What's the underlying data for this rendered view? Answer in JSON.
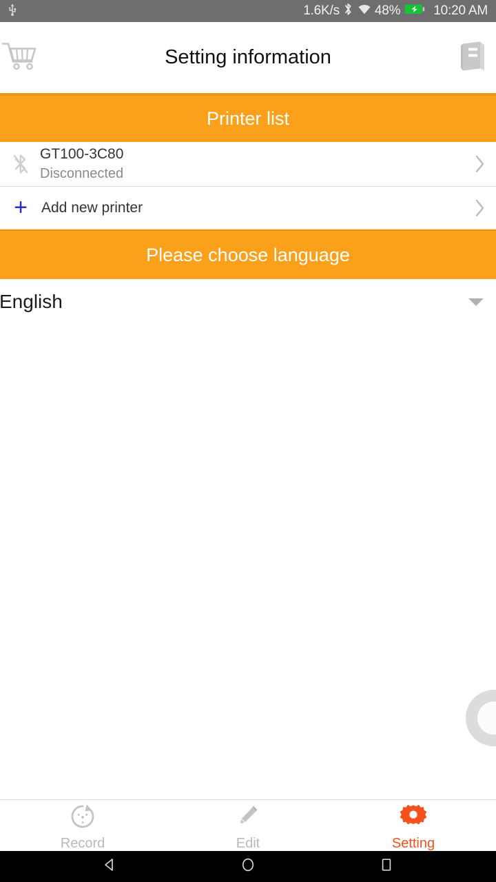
{
  "statusbar": {
    "usb_icon": "usb-icon",
    "network_speed": "1.6K/s",
    "bluetooth_icon": "bluetooth-icon",
    "wifi_icon": "wifi-icon",
    "battery_percent": "48%",
    "battery_icon": "battery-charging-icon",
    "time": "10:20 AM",
    "background_color": "#6e6e6e"
  },
  "header": {
    "cart_icon": "shopping-cart-icon",
    "title": "Setting information",
    "book_icon": "book-icon",
    "underline_color": "#e0a21c"
  },
  "printer_section": {
    "header_label": "Printer list",
    "header_color": "#faa01a",
    "rows": [
      {
        "icon": "bluetooth-off-icon",
        "name": "GT100-3C80",
        "status": "Disconnected",
        "chevron_icon": "chevron-right-icon"
      }
    ],
    "add_new": {
      "icon": "plus-icon",
      "icon_color": "#2b2bd6",
      "label": "Add new printer",
      "chevron_icon": "chevron-right-icon"
    }
  },
  "language_section": {
    "header_label": "Please choose language",
    "header_color": "#faa01a",
    "selected": "English",
    "caret_icon": "caret-down-icon"
  },
  "overlay": {
    "spinner_icon": "loading-circle-icon"
  },
  "tabbar": {
    "tabs": [
      {
        "icon": "record-gauge-icon",
        "label": "Record",
        "active": false
      },
      {
        "icon": "pencil-icon",
        "label": "Edit",
        "active": false
      },
      {
        "icon": "gear-icon",
        "label": "Setting",
        "active": true
      }
    ],
    "active_color": "#f4511e",
    "inactive_color": "#b9b9b9"
  },
  "navbar": {
    "back_icon": "back-triangle-icon",
    "home_icon": "home-circle-icon",
    "recents_icon": "recents-square-icon"
  }
}
